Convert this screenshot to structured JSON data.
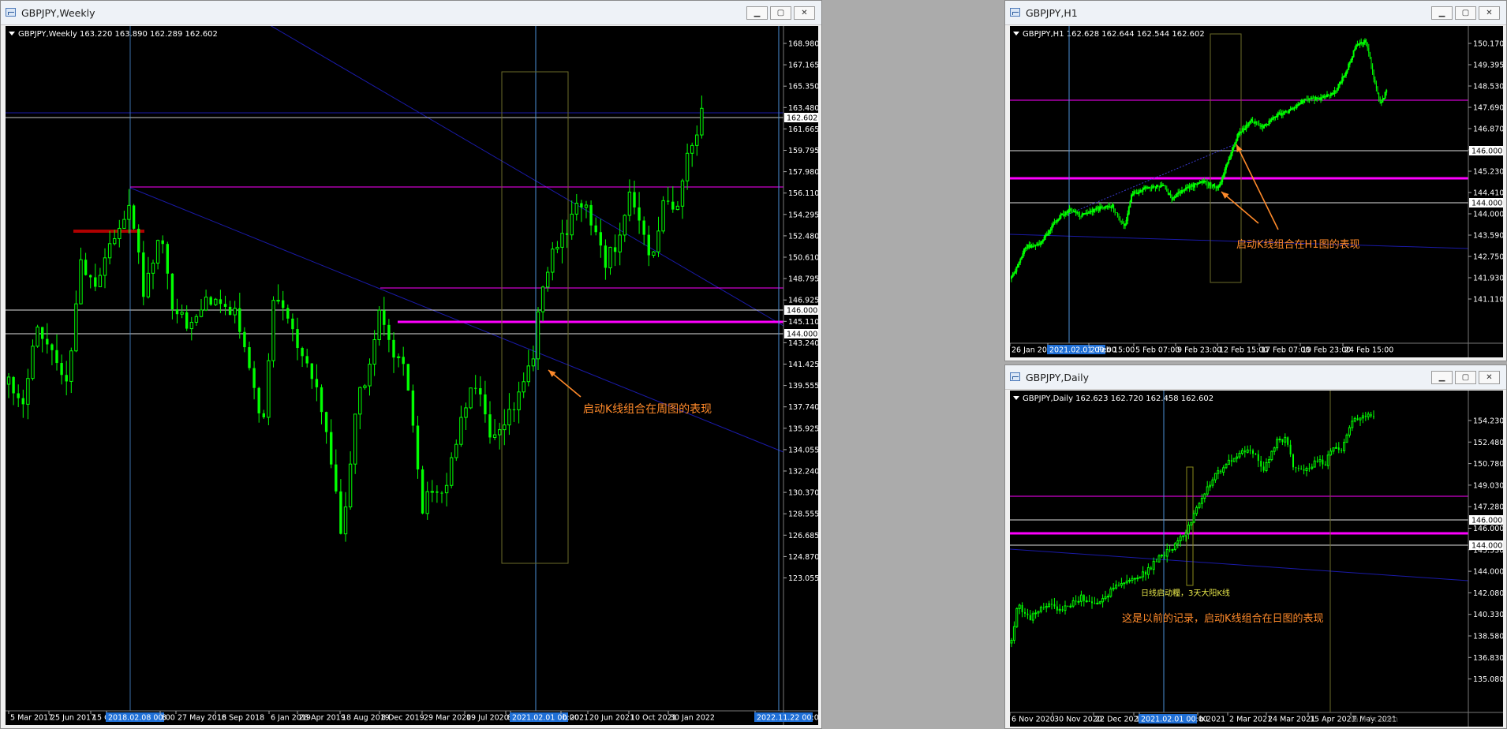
{
  "theme": {
    "background": "#000000",
    "candle": "#00ff00",
    "grid_fg": "#ffffff",
    "magenta": "#ff00ff",
    "trend_blue": "#1a1aa8",
    "vline": "#4d8fd6",
    "box": "#6b6b2a",
    "arrow": "#ff8a2a",
    "red_mark": "#b00000",
    "time_hl": "#1f6fd6"
  },
  "weekly": {
    "title": "GBPJPY,Weekly",
    "legend": "GBPJPY,Weekly  163.220 163.890 162.289 162.602",
    "yticks": [
      "168.980",
      "167.165",
      "165.350",
      "163.480",
      "161.665",
      "159.795",
      "157.980",
      "156.110",
      "154.295",
      "152.480",
      "150.610",
      "148.795",
      "146.925",
      "145.110",
      "143.240",
      "141.425",
      "139.555",
      "137.740",
      "135.925",
      "134.055",
      "132.240",
      "130.370",
      "128.555",
      "126.685",
      "124.870",
      "123.055"
    ],
    "price_labels": [
      "162.602",
      "146.000",
      "144.000"
    ],
    "xticks": [
      "5 Mar 2017",
      "25 Jun 2017",
      "15 Oc",
      "2018.02.08 00:00",
      "8",
      "27 May 2018",
      "16 Sep 2018",
      "6 Jan 2019",
      "28 Apr 2019",
      "18 Aug 2019",
      "8 Dec 2019",
      "29 Mar 2020",
      "19 Jul 2020",
      "8",
      "2021.02.01 00:00",
      "b 2021",
      "20 Jun 2021",
      "10 Oct 2021",
      "30 Jan 2022",
      "2022.11.22 00:00"
    ],
    "annotation": "启动K线组合在周图的表现"
  },
  "h1": {
    "title": "GBPJPY,H1",
    "legend": "GBPJPY,H1  162.628 162.644 162.544 162.602",
    "yticks": [
      "150.170",
      "149.395",
      "148.530",
      "147.690",
      "146.870",
      "146.000",
      "145.230",
      "144.410",
      "144.000",
      "143.590",
      "142.750",
      "141.930",
      "141.110"
    ],
    "price_labels": [
      "146.000",
      "144.000"
    ],
    "xticks": [
      "26 Jan 2021",
      "2021.02.01 00:00",
      "2 Feb 15:00",
      "5 Feb 07:00",
      "9 Feb 23:00",
      "12 Feb 15:00",
      "17 Feb 07:00",
      "19 Feb 23:00",
      "24 Feb 15:00"
    ],
    "annotation": "启动K线组合在H1图的表现"
  },
  "daily": {
    "title": "GBPJPY,Daily",
    "legend": "GBPJPY,Daily  162.623 162.720 162.458 162.602",
    "yticks": [
      "154.230",
      "152.480",
      "150.780",
      "149.030",
      "147.280",
      "146.000",
      "145.530",
      "144.000",
      "142.080",
      "140.330",
      "138.580",
      "136.830",
      "135.080"
    ],
    "price_labels": [
      "146.000",
      "144.000"
    ],
    "xticks": [
      "6 Nov 2020",
      "30 Nov 2020",
      "22 Dec 2020",
      "1",
      "2021.02.01 00:00",
      "b 2021",
      "2 Mar 2021",
      "24 Mar 2021",
      "15 Apr 2021",
      "7 May 2021"
    ],
    "note_small": "日线启动糧，3天大阳K线",
    "annotation": "这是以前的记录，启动K线组合在日图的表现"
  },
  "watermark": "ia.lkfx.com"
}
